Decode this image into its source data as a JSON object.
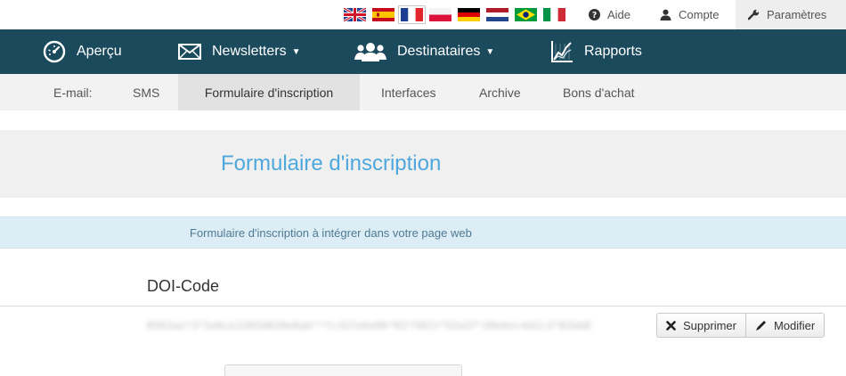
{
  "topbar": {
    "flags": [
      {
        "name": "uk-flag",
        "colors": [
          "#1f3f8f",
          "#ffffff",
          "#cf142b"
        ]
      },
      {
        "name": "spain-flag",
        "colors": [
          "#c60b1e",
          "#ffc400"
        ]
      },
      {
        "name": "france-flag",
        "colors": [
          "#1d3f91",
          "#ffffff",
          "#e1262c"
        ]
      },
      {
        "name": "poland-flag",
        "colors": [
          "#ffffff",
          "#dc143c"
        ]
      },
      {
        "name": "germany-flag",
        "colors": [
          "#000000",
          "#dd0000",
          "#ffce00"
        ]
      },
      {
        "name": "netherlands-flag",
        "colors": [
          "#ae1c28",
          "#ffffff",
          "#21468b"
        ]
      },
      {
        "name": "brazil-flag",
        "colors": [
          "#009b3a",
          "#fedf00",
          "#002776"
        ]
      },
      {
        "name": "italy-flag",
        "colors": [
          "#009246",
          "#ffffff",
          "#ce2b37"
        ]
      }
    ],
    "aide": "Aide",
    "compte": "Compte",
    "parametres": "Paramètres"
  },
  "mainnav": {
    "apercu": "Aperçu",
    "newsletters": "Newsletters",
    "destinataires": "Destinataires",
    "rapports": "Rapports",
    "caret": "▼"
  },
  "subnav": {
    "email": "E-mail:",
    "sms": "SMS",
    "formulaire": "Formulaire d'inscription",
    "interfaces": "Interfaces",
    "archive": "Archive",
    "bons": "Bons d'achat"
  },
  "page": {
    "title": "Formulaire d'inscription",
    "info": "Formulaire d'inscription à intégrer dans votre page web"
  },
  "doi": {
    "heading": "DOI-Code",
    "code": "8563ae*3*5e0ce3305d039e0ab**fc32fe6e06*83*5821*52a3f*30e6ec4d2c3*82bb8",
    "delete_label": "Supprimer",
    "edit_label": "Modifier"
  },
  "colors": {
    "nav_bg": "#1b4a5d",
    "title_blue": "#4ea8dd",
    "info_bg": "#dcedf6"
  }
}
